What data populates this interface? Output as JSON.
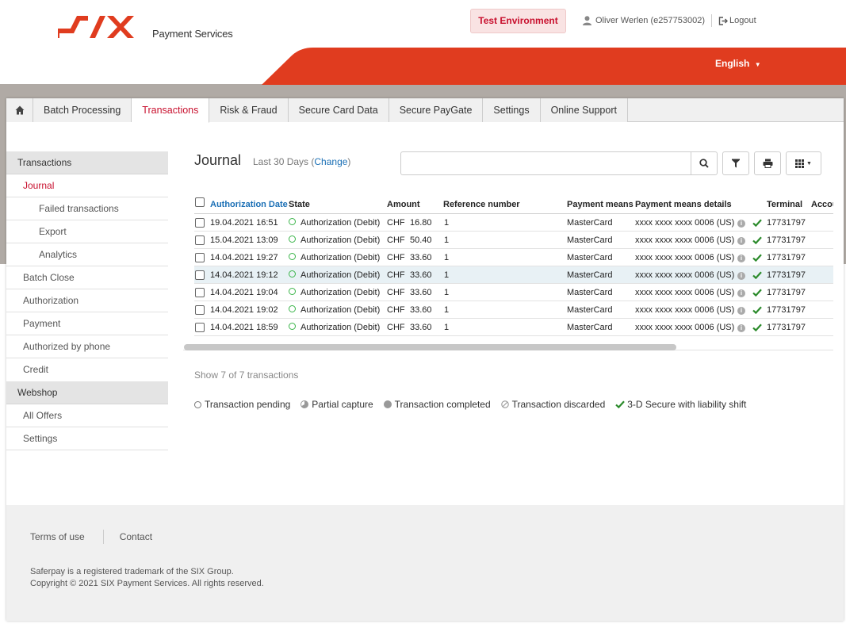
{
  "header": {
    "logo_text": "SIX",
    "logo_sub": "Payment Services",
    "environment_badge": "Test Environment",
    "user_name": "Oliver Werlen (e257753002)",
    "logout_label": "Logout",
    "language": "English",
    "brand_red": "#e03c1f"
  },
  "nav": {
    "home_icon": "home-icon",
    "tabs": [
      {
        "label": "Batch Processing"
      },
      {
        "label": "Transactions",
        "active": true
      },
      {
        "label": "Risk & Fraud"
      },
      {
        "label": "Secure Card Data"
      },
      {
        "label": "Secure PayGate"
      },
      {
        "label": "Settings"
      },
      {
        "label": "Online Support"
      }
    ]
  },
  "sidebar": {
    "sections": [
      {
        "label": "Transactions"
      },
      {
        "label": "Webshop"
      }
    ],
    "items": [
      {
        "label": "Journal"
      },
      {
        "label": "Failed transactions"
      },
      {
        "label": "Export"
      },
      {
        "label": "Analytics"
      },
      {
        "label": "Batch Close"
      },
      {
        "label": "Authorization"
      },
      {
        "label": "Payment"
      },
      {
        "label": "Authorized by phone"
      },
      {
        "label": "Credit"
      },
      {
        "label": "All Offers"
      },
      {
        "label": "Settings"
      }
    ]
  },
  "journal": {
    "title": "Journal",
    "period": "Last 30 Days (",
    "change_link": "Change",
    "period_close": ")",
    "search_placeholder": ""
  },
  "table": {
    "headers": [
      "Authorization Date",
      "State",
      "Amount",
      "Reference number",
      "Payment means",
      "Payment means details",
      "Terminal",
      "Accou"
    ],
    "rows": [
      {
        "date": "19.04.2021 16:51",
        "state": "Authorization (Debit)",
        "currency": "CHF",
        "amount": "16.80",
        "ref": "1",
        "means": "MasterCard",
        "details": "xxxx xxxx xxxx 0006 (US)",
        "terminal": "17731797"
      },
      {
        "date": "15.04.2021 13:09",
        "state": "Authorization (Debit)",
        "currency": "CHF",
        "amount": "50.40",
        "ref": "1",
        "means": "MasterCard",
        "details": "xxxx xxxx xxxx 0006 (US)",
        "terminal": "17731797"
      },
      {
        "date": "14.04.2021 19:27",
        "state": "Authorization (Debit)",
        "currency": "CHF",
        "amount": "33.60",
        "ref": "1",
        "means": "MasterCard",
        "details": "xxxx xxxx xxxx 0006 (US)",
        "terminal": "17731797"
      },
      {
        "date": "14.04.2021 19:12",
        "state": "Authorization (Debit)",
        "currency": "CHF",
        "amount": "33.60",
        "ref": "1",
        "means": "MasterCard",
        "details": "xxxx xxxx xxxx 0006 (US)",
        "terminal": "17731797"
      },
      {
        "date": "14.04.2021 19:04",
        "state": "Authorization (Debit)",
        "currency": "CHF",
        "amount": "33.60",
        "ref": "1",
        "means": "MasterCard",
        "details": "xxxx xxxx xxxx 0006 (US)",
        "terminal": "17731797"
      },
      {
        "date": "14.04.2021 19:02",
        "state": "Authorization (Debit)",
        "currency": "CHF",
        "amount": "33.60",
        "ref": "1",
        "means": "MasterCard",
        "details": "xxxx xxxx xxxx 0006 (US)",
        "terminal": "17731797"
      },
      {
        "date": "14.04.2021 18:59",
        "state": "Authorization (Debit)",
        "currency": "CHF",
        "amount": "33.60",
        "ref": "1",
        "means": "MasterCard",
        "details": "xxxx xxxx xxxx 0006 (US)",
        "terminal": "17731797"
      }
    ]
  },
  "summary": {
    "count_text": "Show 7 of 7 transactions"
  },
  "legend": {
    "items": [
      "Transaction pending",
      "Partial capture",
      "Transaction completed",
      "Transaction discarded",
      "3-D Secure with liability shift"
    ]
  },
  "footer": {
    "links": [
      "Terms of use",
      "Contact"
    ],
    "trademark": "Saferpay is a registered trademark of the SIX Group.",
    "copyright": "Copyright © 2021 SIX Payment Services. All rights reserved."
  }
}
